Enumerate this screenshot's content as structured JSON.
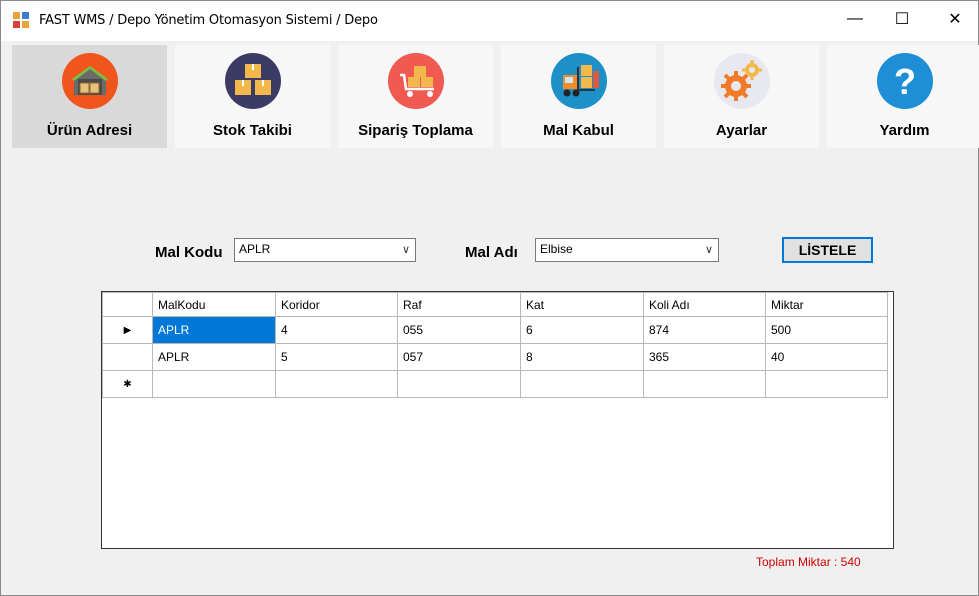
{
  "window": {
    "title": "FAST WMS / Depo Yönetim Otomasyon Sistemi / Depo",
    "min_glyph": "—",
    "max_glyph": "☐",
    "close_glyph": "✕"
  },
  "toolbar": {
    "items": [
      {
        "label": "Ürün Adresi",
        "icon": "warehouse-icon",
        "color": "#f0551e"
      },
      {
        "label": "Stok Takibi",
        "icon": "boxes-icon",
        "color": "#3c3b66"
      },
      {
        "label": "Sipariş Toplama",
        "icon": "cart-icon",
        "color": "#f05a50"
      },
      {
        "label": "Mal Kabul",
        "icon": "forklift-icon",
        "color": "#1e90c8"
      },
      {
        "label": "Ayarlar",
        "icon": "gears-icon",
        "color": "#e8e8f0"
      },
      {
        "label": "Yardım",
        "icon": "help-icon",
        "color": "#1e8ed6"
      }
    ]
  },
  "filters": {
    "mal_kodu_label": "Mal Kodu",
    "mal_kodu_value": "APLR",
    "mal_adi_label": "Mal Adı",
    "mal_adi_value": "Elbise",
    "list_button": "LİSTELE"
  },
  "table": {
    "columns": [
      "MalKodu",
      "Koridor",
      "Raf",
      "Kat",
      "Koli Adı",
      "Miktar"
    ],
    "rows": [
      [
        "APLR",
        "4",
        "055",
        "6",
        "874",
        "500"
      ],
      [
        "APLR",
        "5",
        "057",
        "8",
        "365",
        "40"
      ]
    ],
    "current_row_marker": "▶",
    "new_row_marker": "✱"
  },
  "summary": {
    "total": "Toplam Miktar : 540"
  }
}
